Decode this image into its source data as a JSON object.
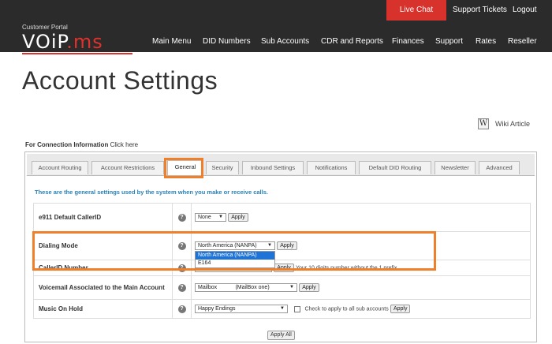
{
  "header": {
    "brand_sub": "Customer Portal",
    "brand_main": "VOiP",
    "brand_tail": ".ms",
    "live_chat": "Live Chat",
    "support_tickets": "Support Tickets",
    "logout": "Logout",
    "nav": [
      "Main Menu",
      "DID Numbers",
      "Sub Accounts",
      "CDR and Reports",
      "Finances",
      "Support",
      "Rates",
      "Reseller"
    ]
  },
  "page": {
    "title": "Account Settings",
    "wiki_label": "Wiki Article",
    "conn_label": "For Connection Information",
    "conn_link": "Click here",
    "intro": "These are the general settings used by the system when you make or receive calls."
  },
  "tabs": [
    "Account Routing",
    "Account Restrictions",
    "General",
    "Security",
    "Inbound Settings",
    "Notifications",
    "Default DID Routing",
    "Newsletter",
    "Advanced"
  ],
  "settings": {
    "e911": {
      "label": "e911 Default CallerID",
      "value": "None",
      "apply": "Apply"
    },
    "dialing": {
      "label": "Dialing Mode",
      "value": "North America (NANPA)",
      "apply": "Apply",
      "options": [
        "North America (NANPA)",
        "E164"
      ]
    },
    "callerid": {
      "label": "CallerID Number",
      "apply": "Apply",
      "hint": "Your 10 digits number without the 1 prefix"
    },
    "voicemail": {
      "label": "Voicemail Associated to the Main Account",
      "value": "Mailbox",
      "value2": "(MailBox one)",
      "apply": "Apply"
    },
    "moh": {
      "label": "Music On Hold",
      "value": "Happy Endings",
      "checkbox_label": "Check to apply to all sub accounts",
      "apply": "Apply"
    },
    "apply_all": "Apply All"
  },
  "colors": {
    "header_bg": "#2b2b2b",
    "live_chat": "#d8322c",
    "highlight": "#f07f2a",
    "intro": "#2a7fb3"
  }
}
